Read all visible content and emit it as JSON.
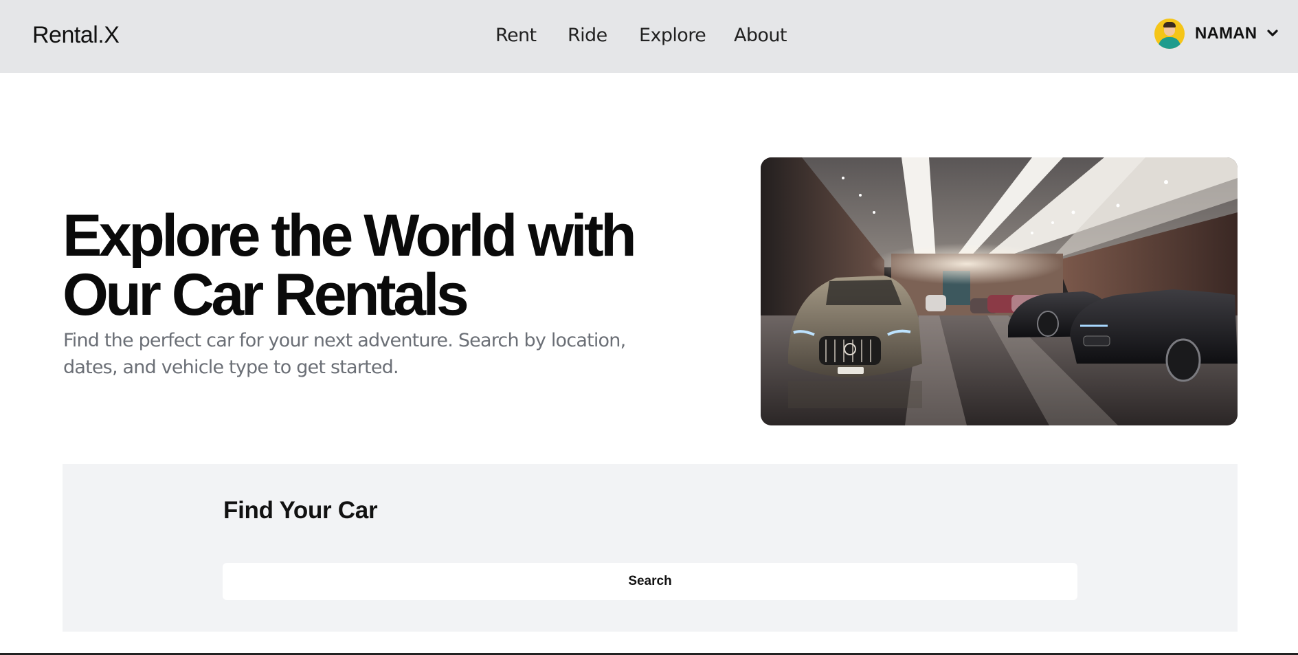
{
  "header": {
    "brand": "Rental.X",
    "nav": [
      "Rent",
      "Ride",
      "Explore",
      "About"
    ],
    "user": {
      "name": "NAMAN",
      "avatar_icon": "user-avatar-icon",
      "menu_icon": "chevron-down-icon"
    }
  },
  "hero": {
    "title": "Explore the World with Our Car Rentals",
    "subtitle": "Find the perfect car for your next adventure. Search by location, dates, and vehicle type to get started.",
    "image": "showroom-cars-image"
  },
  "search": {
    "title": "Find Your Car",
    "button_label": "Search"
  },
  "colors": {
    "header_bg": "#e5e6e8",
    "search_bg": "#f2f3f5",
    "avatar_bg": "#f5c518",
    "subtitle": "#6b6f76"
  }
}
